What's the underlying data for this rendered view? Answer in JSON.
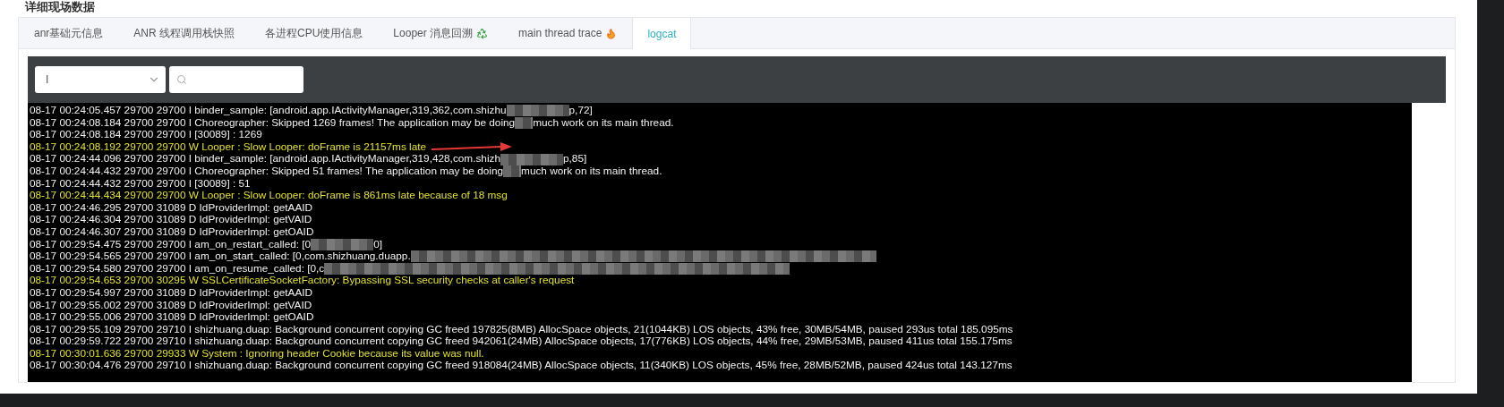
{
  "section_title": "详细现场数据",
  "tabs": [
    {
      "label": "anr基础元信息",
      "selected": false,
      "kind": "text"
    },
    {
      "label": "ANR 线程调用栈快照",
      "selected": false,
      "kind": "text"
    },
    {
      "label": "各进程CPU使用信息",
      "selected": false,
      "kind": "text"
    },
    {
      "label": "Looper 消息回溯",
      "selected": false,
      "kind": "recycle"
    },
    {
      "label": "main thread trace",
      "selected": false,
      "kind": "fire"
    },
    {
      "label": "logcat",
      "selected": true,
      "kind": "text"
    }
  ],
  "toolbar": {
    "level_select": {
      "value": "I"
    }
  },
  "log_lines": [
    {
      "kind": "info",
      "text": "08-17 00:24:05.457 29700 29700 I binder_sample: [android.app.IActivityManager,319,362,com.shizhu",
      "redacted": true,
      "tail": "p,72]"
    },
    {
      "kind": "info",
      "text": "08-17 00:24:08.184 29700 29700 I Choreographer: Skipped 1269 frames! The application may be doing",
      "redacted": true,
      "tail": "much work on its main thread."
    },
    {
      "kind": "info",
      "text": "08-17 00:24:08.184 29700 29700 I [30089] : 1269"
    },
    {
      "kind": "warning",
      "text": "08-17 00:24:08.192 29700 29700 W Looper : Slow Looper: doFrame is 21157ms late",
      "marked": true
    },
    {
      "kind": "info",
      "text": "08-17 00:24:44.096 29700 29700 I binder_sample: [android.app.IActivityManager,319,428,com.shizh",
      "redacted": true,
      "tail": "p,85]"
    },
    {
      "kind": "info",
      "text": "08-17 00:24:44.432 29700 29700 I Choreographer: Skipped 51 frames! The application may be doing",
      "redacted": true,
      "tail": "much work on its main thread."
    },
    {
      "kind": "info",
      "text": "08-17 00:24:44.432 29700 29700 I [30089] : 51"
    },
    {
      "kind": "warning",
      "text": "08-17 00:24:44.434 29700 29700 W Looper : Slow Looper: doFrame is 861ms late because of 18 msg"
    },
    {
      "kind": "info",
      "text": "08-17 00:24:46.295 29700 31089 D IdProviderImpl: getAAID"
    },
    {
      "kind": "info",
      "text": "08-17 00:24:46.304 29700 31089 D IdProviderImpl: getVAID"
    },
    {
      "kind": "info",
      "text": "08-17 00:24:46.307 29700 31089 D IdProviderImpl: getOAID"
    },
    {
      "kind": "info",
      "text": "08-17 00:29:54.475 29700 29700 I am_on_restart_called: [0",
      "redacted": true,
      "tail": "0]"
    },
    {
      "kind": "info",
      "text": "08-17 00:29:54.565 29700 29700 I am_on_start_called: [0,com.shizhuang.duapp.",
      "redacted": true
    },
    {
      "kind": "info",
      "text": "08-17 00:29:54.580 29700 29700 I am_on_resume_called: [0,c",
      "redacted": true
    },
    {
      "kind": "warning",
      "text": "08-17 00:29:54.653 29700 30295 W SSLCertificateSocketFactory: Bypassing SSL security checks at caller's request"
    },
    {
      "kind": "info",
      "text": "08-17 00:29:54.997 29700 31089 D IdProviderImpl: getAAID"
    },
    {
      "kind": "info",
      "text": "08-17 00:29:55.002 29700 31089 D IdProviderImpl: getVAID"
    },
    {
      "kind": "info",
      "text": "08-17 00:29:55.006 29700 31089 D IdProviderImpl: getOAID"
    },
    {
      "kind": "info",
      "text": "08-17 00:29:55.109 29700 29710 I shizhuang.duap: Background concurrent copying GC freed 197825(8MB) AllocSpace objects, 21(1044KB) LOS objects, 43% free, 30MB/54MB, paused 293us total 185.095ms"
    },
    {
      "kind": "info",
      "text": "08-17 00:29:59.722 29700 29710 I shizhuang.duap: Background concurrent copying GC freed 942061(24MB) AllocSpace objects, 17(776KB) LOS objects, 44% free, 29MB/53MB, paused 411us total 155.175ms"
    },
    {
      "kind": "warning",
      "text": "08-17 00:30:01.636 29700 29933 W System : Ignoring header Cookie because its value was null."
    },
    {
      "kind": "info",
      "text": "08-17 00:30:04.476 29700 29710 I shizhuang.duap: Background concurrent copying GC freed 918084(24MB) AllocSpace objects, 11(340KB) LOS objects, 45% free, 28MB/52MB, paused 424us total 143.127ms"
    }
  ]
}
